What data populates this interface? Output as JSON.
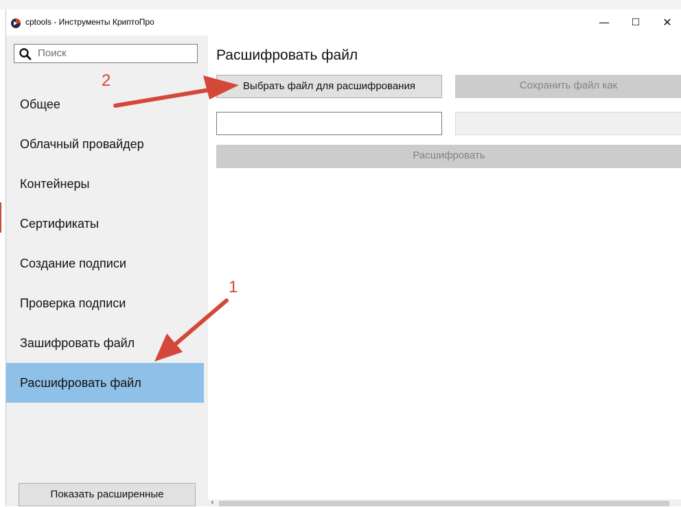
{
  "window": {
    "title": "cptools - Инструменты КриптоПро",
    "controls": {
      "minimize": "—",
      "maximize": "☐",
      "close": "✕"
    },
    "app_icon": "cryptopro-icon"
  },
  "sidebar": {
    "search_placeholder": "Поиск",
    "items": [
      {
        "label": "Общее",
        "active": false
      },
      {
        "label": "Облачный провайдер",
        "active": false
      },
      {
        "label": "Контейнеры",
        "active": false
      },
      {
        "label": "Сертификаты",
        "active": false
      },
      {
        "label": "Создание подписи",
        "active": false
      },
      {
        "label": "Проверка подписи",
        "active": false
      },
      {
        "label": "Зашифровать файл",
        "active": false
      },
      {
        "label": "Расшифровать файл",
        "active": true
      }
    ],
    "advanced_button": "Показать расширенные"
  },
  "main": {
    "title": "Расшифровать файл",
    "choose_file_button": "Выбрать файл для расшифрования",
    "save_as_button": "Сохранить файл как",
    "input_file_value": "",
    "output_file_value": "",
    "decrypt_button": "Расшифровать"
  },
  "annotations": {
    "step1": "1",
    "step2": "2",
    "color": "#d4483a"
  },
  "colors": {
    "active_item": "#8fc0e8",
    "sidebar_bg": "#f0f0f0",
    "disabled_button": "#cccccc"
  }
}
